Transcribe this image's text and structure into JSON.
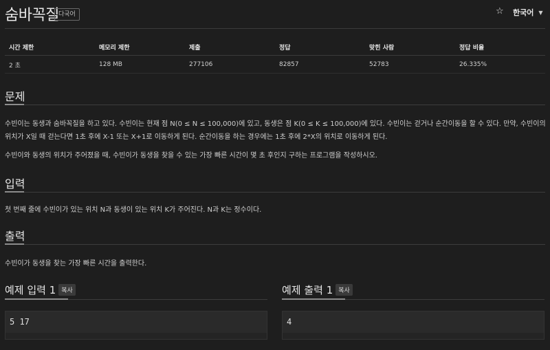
{
  "header": {
    "title": "숨바꼭질",
    "badge": "다국어",
    "star_icon": "star-icon",
    "language": "한국어",
    "caret_icon": "chevron-down-icon"
  },
  "info": {
    "headers": [
      "시간 제한",
      "메모리 제한",
      "제출",
      "정답",
      "맞힌 사람",
      "정답 비율"
    ],
    "values": [
      "2 초",
      "128 MB",
      "277106",
      "82857",
      "52783",
      "26.335%"
    ]
  },
  "problem": {
    "title": "문제",
    "line1": "수빈이는 동생과 숨바꼭질을 하고 있다. 수빈이는 현재 점 N(0 ≤ N ≤ 100,000)에 있고, 동생은 점 K(0 ≤ K ≤ 100,000)에 있다. 수빈이는 걷거나 순간이동을 할 수 있다. 만약, 수빈이의",
    "line2": "위치가 X일 때 걷는다면 1초 후에 X-1 또는 X+1로 이동하게 된다. 순간이동을 하는 경우에는 1초 후에 2*X의 위치로 이동하게 된다.",
    "line3": "수빈이와 동생의 위치가 주어졌을 때, 수빈이가 동생을 찾을 수 있는 가장 빠른 시간이 몇 초 후인지 구하는 프로그램을 작성하시오."
  },
  "input": {
    "title": "입력",
    "text": "첫 번째 줄에 수빈이가 있는 위치 N과 동생이 있는 위치 K가 주어진다. N과 K는 정수이다."
  },
  "output": {
    "title": "출력",
    "text": "수빈이가 동생을 찾는 가장 빠른 시간을 출력한다."
  },
  "examples": {
    "input_title": "예제 입력 1",
    "output_title": "예제 출력 1",
    "copy_label": "복사",
    "input_value": "5 17",
    "output_value": "4"
  }
}
